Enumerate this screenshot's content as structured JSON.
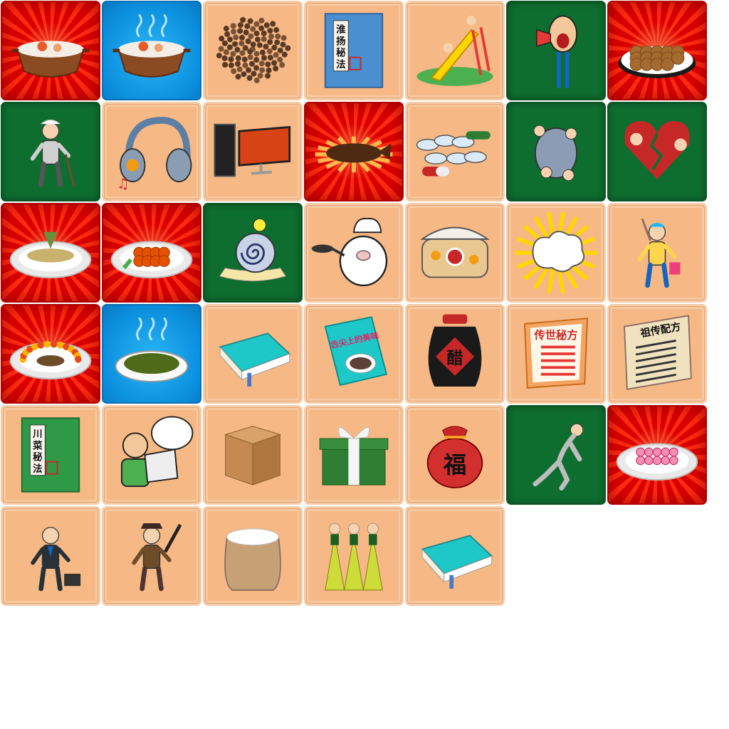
{
  "tiles": [
    {
      "row": 0,
      "col": 0,
      "bg": "red",
      "icon": "clay-pot-soup-icon"
    },
    {
      "row": 0,
      "col": 1,
      "bg": "blue",
      "icon": "steaming-clay-pot-icon"
    },
    {
      "row": 0,
      "col": 2,
      "bg": "peach",
      "icon": "peppercorns-icon"
    },
    {
      "row": 0,
      "col": 3,
      "bg": "peach",
      "icon": "huaiyang-recipe-book-icon",
      "label": "淮扬秘法"
    },
    {
      "row": 0,
      "col": 4,
      "bg": "peach",
      "icon": "playground-slide-icon"
    },
    {
      "row": 0,
      "col": 5,
      "bg": "green",
      "icon": "shouting-man-megaphone-icon"
    },
    {
      "row": 0,
      "col": 6,
      "bg": "red",
      "icon": "braised-meatballs-icon"
    },
    {
      "row": 1,
      "col": 0,
      "bg": "green",
      "icon": "old-man-cane-icon"
    },
    {
      "row": 1,
      "col": 1,
      "bg": "peach",
      "icon": "headphones-icon"
    },
    {
      "row": 1,
      "col": 2,
      "bg": "peach",
      "icon": "desktop-computer-icon"
    },
    {
      "row": 1,
      "col": 3,
      "bg": "red",
      "icon": "braised-fish-dish-icon"
    },
    {
      "row": 1,
      "col": 4,
      "bg": "peach",
      "icon": "pills-capsules-icon"
    },
    {
      "row": 1,
      "col": 5,
      "bg": "green",
      "icon": "crowd-fight-icon"
    },
    {
      "row": 1,
      "col": 6,
      "bg": "green",
      "icon": "broken-heart-couple-icon"
    },
    {
      "row": 2,
      "col": 0,
      "bg": "red",
      "icon": "fish-platter-icon"
    },
    {
      "row": 2,
      "col": 1,
      "bg": "red",
      "icon": "sweet-sour-pork-icon"
    },
    {
      "row": 2,
      "col": 2,
      "bg": "green",
      "icon": "snail-icon"
    },
    {
      "row": 2,
      "col": 3,
      "bg": "peach",
      "icon": "pig-chef-icon"
    },
    {
      "row": 2,
      "col": 4,
      "bg": "peach",
      "icon": "rice-cooker-icon"
    },
    {
      "row": 2,
      "col": 5,
      "bg": "peach",
      "icon": "cleaning-explosion-icon"
    },
    {
      "row": 2,
      "col": 6,
      "bg": "peach",
      "icon": "cleaning-lady-icon"
    },
    {
      "row": 3,
      "col": 0,
      "bg": "red",
      "icon": "peacock-fish-platter-icon"
    },
    {
      "row": 3,
      "col": 1,
      "bg": "blue",
      "icon": "seaweed-soup-icon"
    },
    {
      "row": 3,
      "col": 2,
      "bg": "peach",
      "icon": "teal-book-icon"
    },
    {
      "row": 3,
      "col": 3,
      "bg": "peach",
      "icon": "taste-of-china-book-icon",
      "label": "舌尖上的美味"
    },
    {
      "row": 3,
      "col": 4,
      "bg": "peach",
      "icon": "vinegar-jar-icon",
      "label": "醋"
    },
    {
      "row": 3,
      "col": 5,
      "bg": "peach",
      "icon": "heirloom-recipe-scroll-icon",
      "label": "传世秘方"
    },
    {
      "row": 3,
      "col": 6,
      "bg": "peach",
      "icon": "secret-formula-scroll-icon",
      "label": "祖传配方"
    },
    {
      "row": 4,
      "col": 0,
      "bg": "peach",
      "icon": "sichuan-recipe-book-icon",
      "label": "川菜秘法"
    },
    {
      "row": 4,
      "col": 1,
      "bg": "peach",
      "icon": "man-at-computer-icon"
    },
    {
      "row": 4,
      "col": 2,
      "bg": "peach",
      "icon": "cardboard-box-icon"
    },
    {
      "row": 4,
      "col": 3,
      "bg": "peach",
      "icon": "gift-box-icon"
    },
    {
      "row": 4,
      "col": 4,
      "bg": "peach",
      "icon": "fortune-bag-icon",
      "label": "福"
    },
    {
      "row": 4,
      "col": 5,
      "bg": "green",
      "icon": "tired-walking-man-icon"
    },
    {
      "row": 4,
      "col": 6,
      "bg": "red",
      "icon": "dessert-platter-icon"
    },
    {
      "row": 5,
      "col": 0,
      "bg": "peach",
      "icon": "businessman-briefcase-icon"
    },
    {
      "row": 5,
      "col": 1,
      "bg": "peach",
      "icon": "security-guard-icon"
    },
    {
      "row": 5,
      "col": 2,
      "bg": "peach",
      "icon": "flour-sack-icon"
    },
    {
      "row": 5,
      "col": 3,
      "bg": "peach",
      "icon": "three-dolls-icon"
    },
    {
      "row": 5,
      "col": 4,
      "bg": "peach",
      "icon": "teal-book-icon"
    }
  ]
}
